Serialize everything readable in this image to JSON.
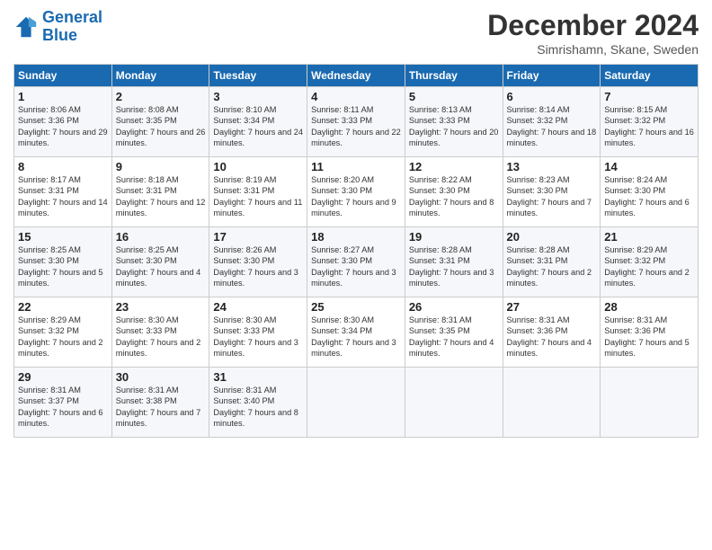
{
  "logo": {
    "line1": "General",
    "line2": "Blue"
  },
  "title": "December 2024",
  "location": "Simrishamn, Skane, Sweden",
  "days_of_week": [
    "Sunday",
    "Monday",
    "Tuesday",
    "Wednesday",
    "Thursday",
    "Friday",
    "Saturday"
  ],
  "weeks": [
    [
      {
        "day": "1",
        "sunrise": "Sunrise: 8:06 AM",
        "sunset": "Sunset: 3:36 PM",
        "daylight": "Daylight: 7 hours and 29 minutes."
      },
      {
        "day": "2",
        "sunrise": "Sunrise: 8:08 AM",
        "sunset": "Sunset: 3:35 PM",
        "daylight": "Daylight: 7 hours and 26 minutes."
      },
      {
        "day": "3",
        "sunrise": "Sunrise: 8:10 AM",
        "sunset": "Sunset: 3:34 PM",
        "daylight": "Daylight: 7 hours and 24 minutes."
      },
      {
        "day": "4",
        "sunrise": "Sunrise: 8:11 AM",
        "sunset": "Sunset: 3:33 PM",
        "daylight": "Daylight: 7 hours and 22 minutes."
      },
      {
        "day": "5",
        "sunrise": "Sunrise: 8:13 AM",
        "sunset": "Sunset: 3:33 PM",
        "daylight": "Daylight: 7 hours and 20 minutes."
      },
      {
        "day": "6",
        "sunrise": "Sunrise: 8:14 AM",
        "sunset": "Sunset: 3:32 PM",
        "daylight": "Daylight: 7 hours and 18 minutes."
      },
      {
        "day": "7",
        "sunrise": "Sunrise: 8:15 AM",
        "sunset": "Sunset: 3:32 PM",
        "daylight": "Daylight: 7 hours and 16 minutes."
      }
    ],
    [
      {
        "day": "8",
        "sunrise": "Sunrise: 8:17 AM",
        "sunset": "Sunset: 3:31 PM",
        "daylight": "Daylight: 7 hours and 14 minutes."
      },
      {
        "day": "9",
        "sunrise": "Sunrise: 8:18 AM",
        "sunset": "Sunset: 3:31 PM",
        "daylight": "Daylight: 7 hours and 12 minutes."
      },
      {
        "day": "10",
        "sunrise": "Sunrise: 8:19 AM",
        "sunset": "Sunset: 3:31 PM",
        "daylight": "Daylight: 7 hours and 11 minutes."
      },
      {
        "day": "11",
        "sunrise": "Sunrise: 8:20 AM",
        "sunset": "Sunset: 3:30 PM",
        "daylight": "Daylight: 7 hours and 9 minutes."
      },
      {
        "day": "12",
        "sunrise": "Sunrise: 8:22 AM",
        "sunset": "Sunset: 3:30 PM",
        "daylight": "Daylight: 7 hours and 8 minutes."
      },
      {
        "day": "13",
        "sunrise": "Sunrise: 8:23 AM",
        "sunset": "Sunset: 3:30 PM",
        "daylight": "Daylight: 7 hours and 7 minutes."
      },
      {
        "day": "14",
        "sunrise": "Sunrise: 8:24 AM",
        "sunset": "Sunset: 3:30 PM",
        "daylight": "Daylight: 7 hours and 6 minutes."
      }
    ],
    [
      {
        "day": "15",
        "sunrise": "Sunrise: 8:25 AM",
        "sunset": "Sunset: 3:30 PM",
        "daylight": "Daylight: 7 hours and 5 minutes."
      },
      {
        "day": "16",
        "sunrise": "Sunrise: 8:25 AM",
        "sunset": "Sunset: 3:30 PM",
        "daylight": "Daylight: 7 hours and 4 minutes."
      },
      {
        "day": "17",
        "sunrise": "Sunrise: 8:26 AM",
        "sunset": "Sunset: 3:30 PM",
        "daylight": "Daylight: 7 hours and 3 minutes."
      },
      {
        "day": "18",
        "sunrise": "Sunrise: 8:27 AM",
        "sunset": "Sunset: 3:30 PM",
        "daylight": "Daylight: 7 hours and 3 minutes."
      },
      {
        "day": "19",
        "sunrise": "Sunrise: 8:28 AM",
        "sunset": "Sunset: 3:31 PM",
        "daylight": "Daylight: 7 hours and 3 minutes."
      },
      {
        "day": "20",
        "sunrise": "Sunrise: 8:28 AM",
        "sunset": "Sunset: 3:31 PM",
        "daylight": "Daylight: 7 hours and 2 minutes."
      },
      {
        "day": "21",
        "sunrise": "Sunrise: 8:29 AM",
        "sunset": "Sunset: 3:32 PM",
        "daylight": "Daylight: 7 hours and 2 minutes."
      }
    ],
    [
      {
        "day": "22",
        "sunrise": "Sunrise: 8:29 AM",
        "sunset": "Sunset: 3:32 PM",
        "daylight": "Daylight: 7 hours and 2 minutes."
      },
      {
        "day": "23",
        "sunrise": "Sunrise: 8:30 AM",
        "sunset": "Sunset: 3:33 PM",
        "daylight": "Daylight: 7 hours and 2 minutes."
      },
      {
        "day": "24",
        "sunrise": "Sunrise: 8:30 AM",
        "sunset": "Sunset: 3:33 PM",
        "daylight": "Daylight: 7 hours and 3 minutes."
      },
      {
        "day": "25",
        "sunrise": "Sunrise: 8:30 AM",
        "sunset": "Sunset: 3:34 PM",
        "daylight": "Daylight: 7 hours and 3 minutes."
      },
      {
        "day": "26",
        "sunrise": "Sunrise: 8:31 AM",
        "sunset": "Sunset: 3:35 PM",
        "daylight": "Daylight: 7 hours and 4 minutes."
      },
      {
        "day": "27",
        "sunrise": "Sunrise: 8:31 AM",
        "sunset": "Sunset: 3:36 PM",
        "daylight": "Daylight: 7 hours and 4 minutes."
      },
      {
        "day": "28",
        "sunrise": "Sunrise: 8:31 AM",
        "sunset": "Sunset: 3:36 PM",
        "daylight": "Daylight: 7 hours and 5 minutes."
      }
    ],
    [
      {
        "day": "29",
        "sunrise": "Sunrise: 8:31 AM",
        "sunset": "Sunset: 3:37 PM",
        "daylight": "Daylight: 7 hours and 6 minutes."
      },
      {
        "day": "30",
        "sunrise": "Sunrise: 8:31 AM",
        "sunset": "Sunset: 3:38 PM",
        "daylight": "Daylight: 7 hours and 7 minutes."
      },
      {
        "day": "31",
        "sunrise": "Sunrise: 8:31 AM",
        "sunset": "Sunset: 3:40 PM",
        "daylight": "Daylight: 7 hours and 8 minutes."
      },
      {
        "day": "",
        "sunrise": "",
        "sunset": "",
        "daylight": ""
      },
      {
        "day": "",
        "sunrise": "",
        "sunset": "",
        "daylight": ""
      },
      {
        "day": "",
        "sunrise": "",
        "sunset": "",
        "daylight": ""
      },
      {
        "day": "",
        "sunrise": "",
        "sunset": "",
        "daylight": ""
      }
    ]
  ]
}
